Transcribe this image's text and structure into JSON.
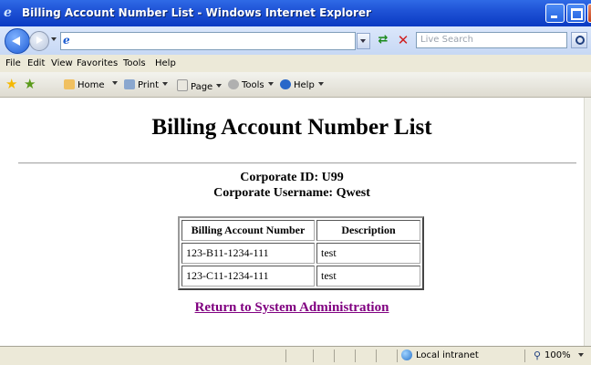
{
  "window": {
    "title": "Billing Account Number List - Windows Internet Explorer"
  },
  "search": {
    "placeholder": "Live Search"
  },
  "menu": [
    "File",
    "Edit",
    "View",
    "Favorites",
    "Tools",
    "Help"
  ],
  "command_bar": {
    "home": "Home",
    "print": "Print",
    "page": "Page",
    "tools": "Tools",
    "help": "Help"
  },
  "page": {
    "title": "Billing Account Number List",
    "corporate_id": "Corporate ID: U99",
    "corporate_username": "Corporate Username: Qwest",
    "table": {
      "headers": [
        "Billing Account Number",
        "Description"
      ],
      "rows": [
        [
          "123-B11-1234-111",
          "test"
        ],
        [
          "123-C11-1234-111",
          "test"
        ]
      ]
    },
    "return_link": "Return to System Administration"
  },
  "status": {
    "zone": "Local intranet",
    "zoom": "100%"
  },
  "colors": {
    "titlebar": "#1f53d6",
    "link_visited": "#800080",
    "chrome": "#ece9d8"
  }
}
